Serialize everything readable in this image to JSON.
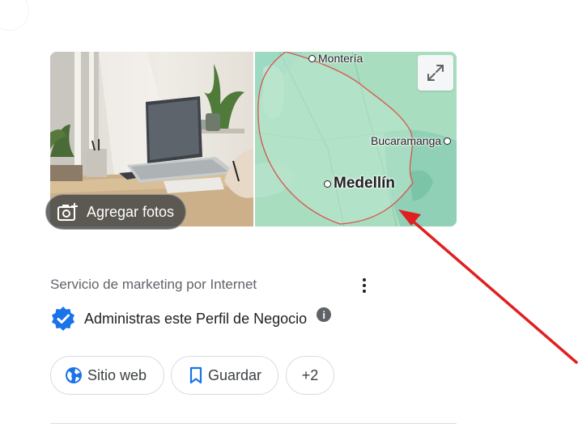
{
  "photo": {
    "add_photos_label": "Agregar fotos"
  },
  "map": {
    "cities": [
      {
        "name": "Montería"
      },
      {
        "name": "Bucaramanga"
      },
      {
        "name": "Medellín"
      }
    ]
  },
  "business": {
    "category": "Servicio de marketing por Internet",
    "verified_text": "Administras este Perfil de Negocio",
    "info_symbol": "i"
  },
  "actions": {
    "website_label": "Sitio web",
    "save_label": "Guardar",
    "more_label": "+2"
  },
  "colors": {
    "accent_blue": "#1a73e8",
    "map_water": "#9ddac4",
    "map_land": "#a9ddc0",
    "area_outline": "#d9534f",
    "annotation_arrow": "#e02020"
  }
}
